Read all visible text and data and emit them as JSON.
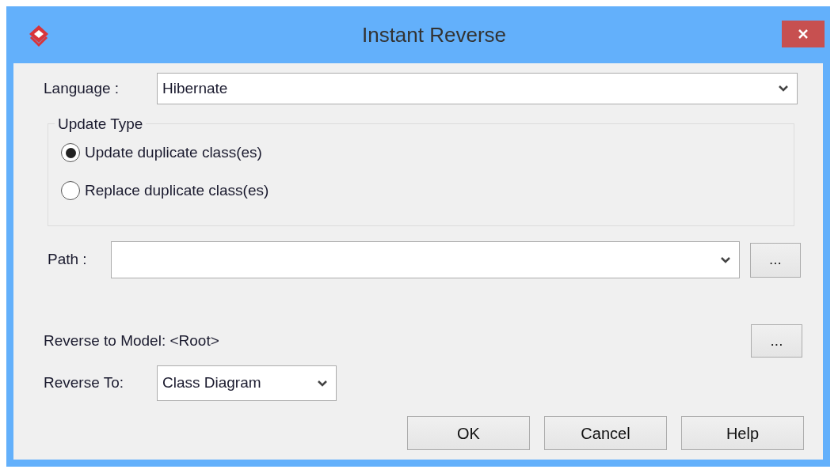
{
  "window": {
    "title": "Instant Reverse"
  },
  "language": {
    "label": "Language :",
    "value": "Hibernate"
  },
  "update_type": {
    "title": "Update Type",
    "options": [
      {
        "label": "Update duplicate class(es)",
        "selected": true
      },
      {
        "label": "Replace duplicate class(es)",
        "selected": false
      }
    ]
  },
  "path": {
    "label": "Path :",
    "browse": "..."
  },
  "reverse_to_model": {
    "label": "Reverse to Model: <Root>",
    "browse": "..."
  },
  "reverse_to": {
    "label": "Reverse To:",
    "value": "Class Diagram"
  },
  "buttons": [
    "OK",
    "Cancel",
    "Help"
  ]
}
